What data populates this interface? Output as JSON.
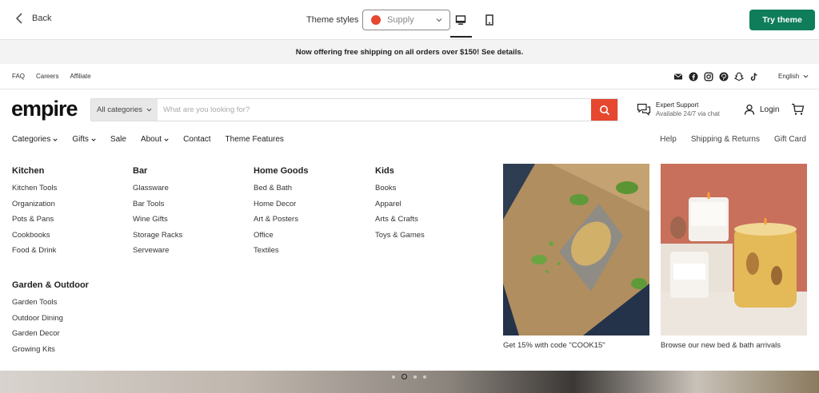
{
  "topbar": {
    "back_label": "Back",
    "theme_label": "Theme styles",
    "theme_value": "Supply",
    "try_label": "Try theme"
  },
  "announcement": "Now offering free shipping on all orders over $150! See details.",
  "utility": {
    "links": [
      "FAQ",
      "Careers",
      "Affiliate"
    ],
    "socials": [
      "mail-icon",
      "facebook-icon",
      "instagram-icon",
      "pinterest-icon",
      "snapchat-icon",
      "tiktok-icon"
    ],
    "language": "English"
  },
  "header": {
    "logo": "empire",
    "search_category": "All categories",
    "search_placeholder": "What are you looking for?",
    "support_title": "Expert Support",
    "support_sub": "Available 24/7 via chat",
    "login_label": "Login"
  },
  "nav": {
    "items": [
      "Categories",
      "Gifts",
      "Sale",
      "About",
      "Contact",
      "Theme Features"
    ],
    "right": [
      "Help",
      "Shipping & Returns",
      "Gift Card"
    ]
  },
  "menu": {
    "kitchen": {
      "title": "Kitchen",
      "items": [
        "Kitchen Tools",
        "Organization",
        "Pots & Pans",
        "Cookbooks",
        "Food & Drink"
      ]
    },
    "bar": {
      "title": "Bar",
      "items": [
        "Glassware",
        "Bar Tools",
        "Wine Gifts",
        "Storage Racks",
        "Serveware"
      ]
    },
    "home": {
      "title": "Home Goods",
      "items": [
        "Bed & Bath",
        "Home Decor",
        "Art & Posters",
        "Office",
        "Textiles"
      ]
    },
    "kids": {
      "title": "Kids",
      "items": [
        "Books",
        "Apparel",
        "Arts & Crafts",
        "Toys & Games"
      ]
    },
    "garden": {
      "title": "Garden & Outdoor",
      "items": [
        "Garden Tools",
        "Outdoor Dining",
        "Garden Decor",
        "Growing Kits"
      ]
    }
  },
  "promos": [
    {
      "caption": "Get 15% with code \"COOK15\""
    },
    {
      "caption": "Browse our new bed & bath arrivals"
    }
  ],
  "colors": {
    "accent": "#e5472f",
    "try_button": "#0f7d5a"
  }
}
